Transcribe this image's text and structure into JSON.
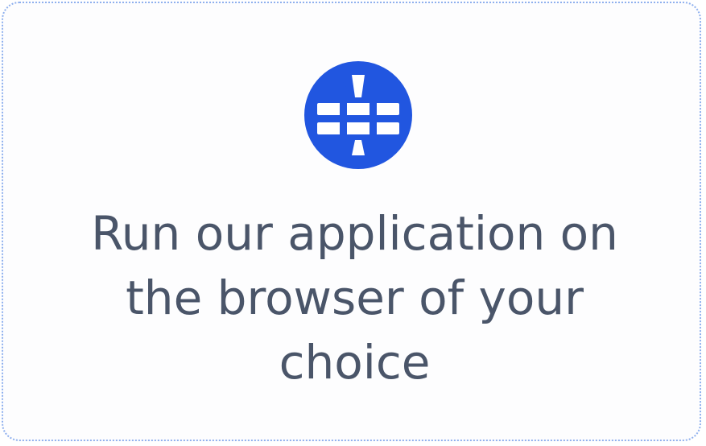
{
  "card": {
    "icon": "globe-icon",
    "icon_color": "#2156e0",
    "caption_lines": [
      "Run our application on",
      "the browser of your",
      "choice"
    ]
  }
}
